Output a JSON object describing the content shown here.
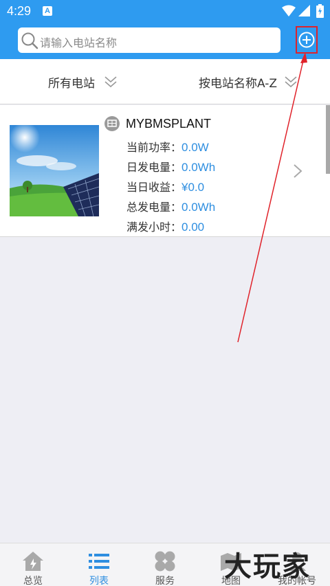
{
  "status_bar": {
    "time": "4:29",
    "notification_badge": "A",
    "icons": [
      "wifi-icon",
      "signal-icon",
      "battery-charging-icon"
    ]
  },
  "header": {
    "search_placeholder": "请输入电站名称",
    "add_icon": "plus-circle-icon"
  },
  "filters": {
    "all_stations": "所有电站",
    "sort_by_name": "按电站名称A-Z"
  },
  "plants": [
    {
      "name": "MYBMSPLANT",
      "fields": [
        {
          "label": "当前功率：",
          "value": "0.0W"
        },
        {
          "label": "日发电量：",
          "value": "0.0Wh"
        },
        {
          "label": "当日收益：",
          "value": "¥0.0"
        },
        {
          "label": "总发电量：",
          "value": "0.0Wh"
        },
        {
          "label": "满发小时：",
          "value": "0.00"
        }
      ]
    }
  ],
  "bottom_nav": [
    {
      "label": "总览",
      "icon": "home-icon",
      "active": false
    },
    {
      "label": "列表",
      "icon": "list-icon",
      "active": true
    },
    {
      "label": "服务",
      "icon": "clover-icon",
      "active": false
    },
    {
      "label": "地图",
      "icon": "map-icon",
      "active": false
    },
    {
      "label": "我的帐号",
      "icon": "account-icon",
      "active": false
    }
  ],
  "watermark": "大玩家",
  "colors": {
    "primary": "#2e9bf0",
    "value_text": "#2e8ee0",
    "annotation": "#e0222a"
  }
}
